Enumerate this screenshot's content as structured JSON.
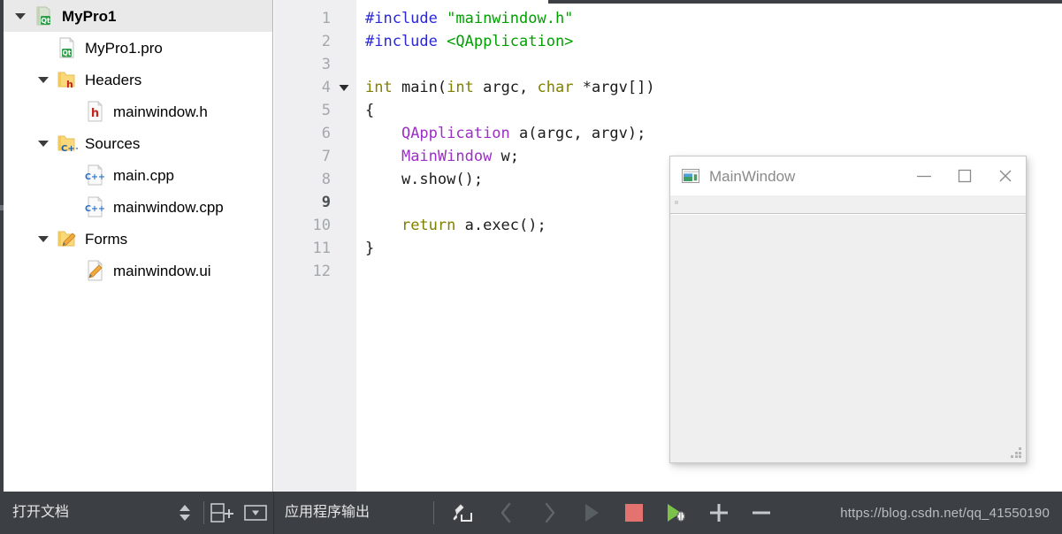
{
  "project_tree": {
    "items": [
      {
        "label": "MyPro1",
        "icon": "qt-project-icon",
        "level": 0,
        "expandable": true,
        "expanded": true,
        "selected": true,
        "bold": true
      },
      {
        "label": "MyPro1.pro",
        "icon": "qt-pro-file-icon",
        "level": 1,
        "expandable": false,
        "expanded": false,
        "selected": false,
        "bold": false
      },
      {
        "label": "Headers",
        "icon": "folder-h-icon",
        "level": 1,
        "expandable": true,
        "expanded": true,
        "selected": false,
        "bold": false
      },
      {
        "label": "mainwindow.h",
        "icon": "h-file-icon",
        "level": 2,
        "expandable": false,
        "expanded": false,
        "selected": false,
        "bold": false
      },
      {
        "label": "Sources",
        "icon": "folder-cpp-icon",
        "level": 1,
        "expandable": true,
        "expanded": true,
        "selected": false,
        "bold": false
      },
      {
        "label": "main.cpp",
        "icon": "cpp-file-icon",
        "level": 2,
        "expandable": false,
        "expanded": false,
        "selected": false,
        "bold": false
      },
      {
        "label": "mainwindow.cpp",
        "icon": "cpp-file-icon",
        "level": 2,
        "expandable": false,
        "expanded": false,
        "selected": false,
        "bold": false
      },
      {
        "label": "Forms",
        "icon": "folder-ui-icon",
        "level": 1,
        "expandable": true,
        "expanded": true,
        "selected": false,
        "bold": false
      },
      {
        "label": "mainwindow.ui",
        "icon": "ui-file-icon",
        "level": 2,
        "expandable": false,
        "expanded": false,
        "selected": false,
        "bold": false
      }
    ]
  },
  "editor": {
    "current_line": 9,
    "lines": [
      {
        "no": "1",
        "fold": false,
        "tokens": [
          {
            "t": "#include ",
            "c": "pre"
          },
          {
            "t": "\"mainwindow.h\"",
            "c": "str"
          }
        ]
      },
      {
        "no": "2",
        "fold": false,
        "tokens": [
          {
            "t": "#include ",
            "c": "pre"
          },
          {
            "t": "<QApplication>",
            "c": "inc"
          }
        ]
      },
      {
        "no": "3",
        "fold": false,
        "tokens": []
      },
      {
        "no": "4",
        "fold": true,
        "tokens": [
          {
            "t": "int",
            "c": "kw"
          },
          {
            "t": " main(",
            "c": "plain"
          },
          {
            "t": "int",
            "c": "kw"
          },
          {
            "t": " argc, ",
            "c": "plain"
          },
          {
            "t": "char",
            "c": "kw"
          },
          {
            "t": " *argv[])",
            "c": "plain"
          }
        ]
      },
      {
        "no": "5",
        "fold": false,
        "tokens": [
          {
            "t": "{",
            "c": "plain"
          }
        ]
      },
      {
        "no": "6",
        "fold": false,
        "tokens": [
          {
            "t": "    ",
            "c": "plain"
          },
          {
            "t": "QApplication",
            "c": "type"
          },
          {
            "t": " a(argc, argv);",
            "c": "plain"
          }
        ]
      },
      {
        "no": "7",
        "fold": false,
        "tokens": [
          {
            "t": "    ",
            "c": "plain"
          },
          {
            "t": "MainWindow",
            "c": "type"
          },
          {
            "t": " w;",
            "c": "plain"
          }
        ]
      },
      {
        "no": "8",
        "fold": false,
        "tokens": [
          {
            "t": "    w.show();",
            "c": "plain"
          }
        ]
      },
      {
        "no": "9",
        "fold": false,
        "tokens": []
      },
      {
        "no": "10",
        "fold": false,
        "tokens": [
          {
            "t": "    ",
            "c": "plain"
          },
          {
            "t": "return",
            "c": "kw"
          },
          {
            "t": " a.exec();",
            "c": "plain"
          }
        ]
      },
      {
        "no": "11",
        "fold": false,
        "tokens": [
          {
            "t": "}",
            "c": "plain"
          }
        ]
      },
      {
        "no": "12",
        "fold": false,
        "tokens": []
      }
    ]
  },
  "mainwindow_popup": {
    "title": "MainWindow",
    "icon": "qt-window-icon",
    "minimize_label": "minimize-icon",
    "maximize_label": "maximize-icon",
    "close_label": "close-icon",
    "grip_label": "resize-grip"
  },
  "bottom_bar": {
    "open_documents_label": "打开文档",
    "nav_updown_icon": "up-down-arrows-icon",
    "split_add_icon": "split-add-icon",
    "dropdown_icon": "dropdown-box-icon",
    "output_pane_label": "应用程序输出",
    "tools": [
      {
        "name": "clear-output-button",
        "icon": "broom-icon"
      },
      {
        "name": "previous-item-button",
        "icon": "chevron-left-icon"
      },
      {
        "name": "next-item-button",
        "icon": "chevron-right-icon"
      },
      {
        "name": "run-button",
        "icon": "play-triangle-icon"
      },
      {
        "name": "stop-button",
        "icon": "stop-square-icon"
      },
      {
        "name": "debug-button",
        "icon": "play-bug-icon"
      },
      {
        "name": "zoom-in-button",
        "icon": "plus-icon"
      },
      {
        "name": "zoom-out-button",
        "icon": "minus-icon"
      }
    ],
    "watermark": "https://blog.csdn.net/qq_41550190"
  },
  "colors": {
    "chrome_dark": "#3c4045",
    "selection": "#e9e9e9",
    "gutter": "#efeff1",
    "preprocessor": "#2b28d4",
    "string": "#00a000",
    "keyword": "#808000",
    "type": "#9b30c4",
    "stop_red": "#e4726f",
    "debug_green": "#7cc24a"
  }
}
